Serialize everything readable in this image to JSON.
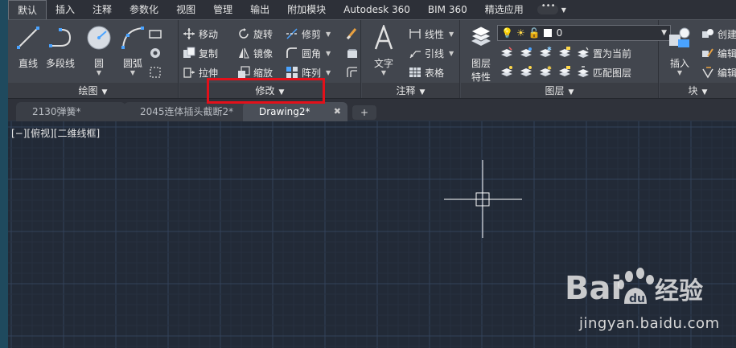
{
  "ribbon_tabs": [
    "默认",
    "插入",
    "注释",
    "参数化",
    "视图",
    "管理",
    "输出",
    "附加模块",
    "Autodesk 360",
    "BIM 360",
    "精选应用"
  ],
  "draw_panel": {
    "title": "绘图",
    "line": "直线",
    "polyline": "多段线",
    "circle": "圆",
    "arc": "圆弧"
  },
  "modify_panel": {
    "title": "修改",
    "move": "移动",
    "rotate": "旋转",
    "trim": "修剪",
    "copy": "复制",
    "mirror": "镜像",
    "fillet": "圆角",
    "stretch": "拉伸",
    "scale": "缩放",
    "array": "阵列"
  },
  "annotation_panel": {
    "title": "注释",
    "text": "文字",
    "dimension": "线性",
    "leader": "引线",
    "table": "表格"
  },
  "layers_panel": {
    "title": "图层",
    "properties_line1": "图层",
    "properties_line2": "特性",
    "current_layer": "0",
    "set_current": "置为当前",
    "match_layer": "匹配图层"
  },
  "block_panel": {
    "title": "块",
    "insert": "插入",
    "create": "创建",
    "edit": "编辑",
    "edit_attrib": "编辑属"
  },
  "file_tabs": [
    {
      "label": "2130弹簧*"
    },
    {
      "label": "2045连体插头截断2*"
    },
    {
      "label": "Drawing2*"
    }
  ],
  "file_tab_add": "+",
  "viewport_label": "[−][俯视][二维线框]",
  "watermark": {
    "site": "jingyan.baidu.com"
  },
  "colors": {
    "canvas_bg": "#222a37",
    "grid_major": "#33425a",
    "grid_minor": "#27303f",
    "ribbon_bg": "#42464e",
    "highlight": "#e3101a"
  }
}
